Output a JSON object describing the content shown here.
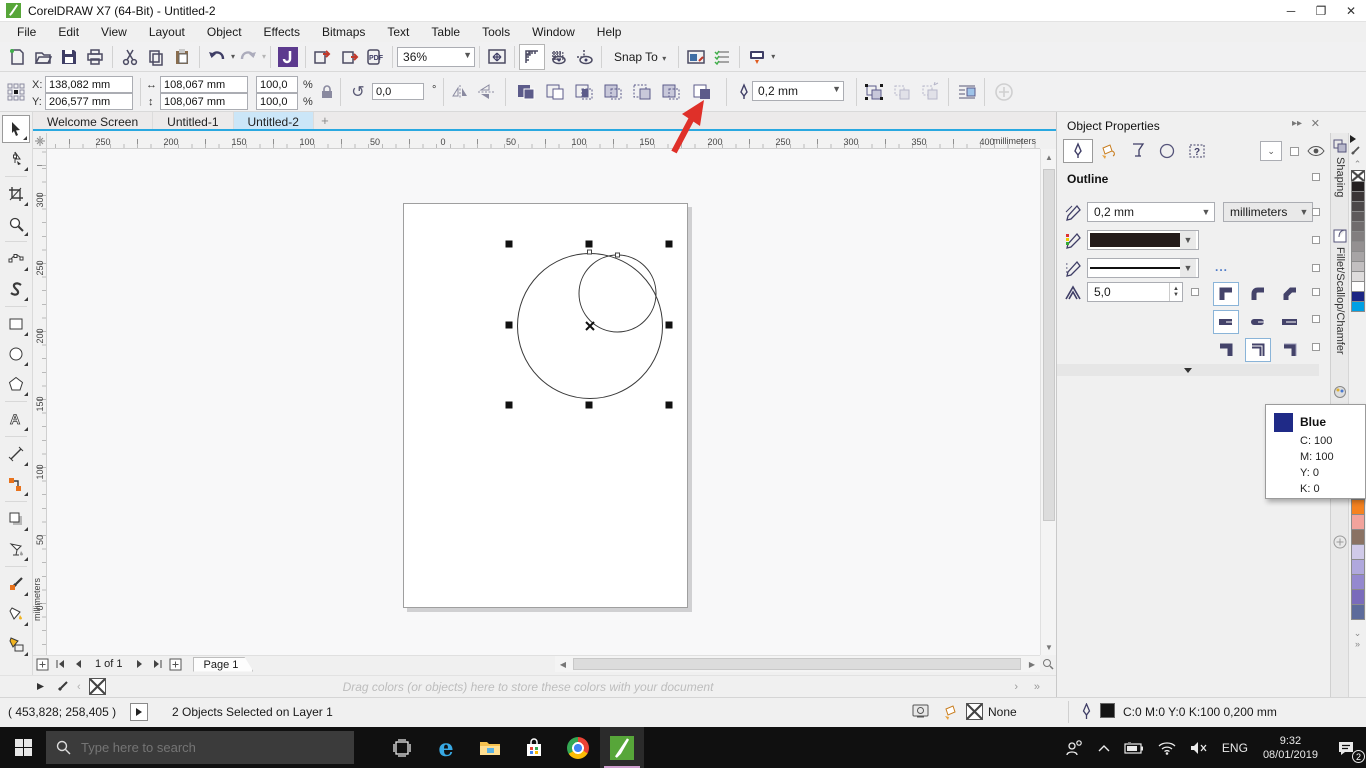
{
  "window": {
    "title": "CorelDRAW X7 (64-Bit) - Untitled-2"
  },
  "menus": [
    "File",
    "Edit",
    "View",
    "Layout",
    "Object",
    "Effects",
    "Bitmaps",
    "Text",
    "Table",
    "Tools",
    "Window",
    "Help"
  ],
  "toolbar": {
    "zoom_value": "36%",
    "snap_label": "Snap To"
  },
  "propbar": {
    "x_label": "X:",
    "y_label": "Y:",
    "x_value": "138,082 mm",
    "y_value": "206,577 mm",
    "width_value": "108,067 mm",
    "height_value": "108,067 mm",
    "scale_h": "100,0",
    "scale_v": "100,0",
    "percent": "%",
    "angle_value": "0,0",
    "degree": "°",
    "outline_width": "0,2 mm"
  },
  "doc_tabs": {
    "tab1": "Welcome Screen",
    "tab2": "Untitled-1",
    "tab3": "Untitled-2",
    "new_tab": "+"
  },
  "rulers": {
    "unit": "millimeters",
    "h_numbers": [
      "250",
      "200",
      "150",
      "100",
      "50",
      "0",
      "50",
      "100",
      "150",
      "200",
      "250",
      "300",
      "350",
      "400"
    ],
    "v_numbers": [
      "300",
      "250",
      "200",
      "150",
      "100",
      "50",
      "0"
    ]
  },
  "object_properties": {
    "title": "Object Properties",
    "section_title": "Outline",
    "width_value": "0,2 mm",
    "units_value": "millimeters",
    "miter_value": "5,0",
    "more_label": "..."
  },
  "docker_tabs": {
    "tab1": "Shaping",
    "tab2": "Fillet/Scallop/Chamfer"
  },
  "tooltip": {
    "name": "Blue",
    "line1": "C: 100",
    "line2": "M: 100",
    "line3": "Y: 0",
    "line4": "K: 0",
    "swatch_color": "#1f2a87"
  },
  "navigation": {
    "page_count": "1 of 1",
    "page_tab": "Page 1"
  },
  "doc_palette_hint": "Drag colors (or objects) here to store these colors with your document",
  "status": {
    "coords": "( 453,828; 258,405 )",
    "selection": "2 Objects Selected on Layer 1",
    "fill_value": "None",
    "outline_value": "C:0 M:0 Y:0 K:100  0,200 mm"
  },
  "taskbar": {
    "search_placeholder": "Type here to search",
    "language": "ENG",
    "time": "9:32",
    "date": "08/01/2019",
    "notification_count": "2"
  },
  "palette_top": [
    "#231f20",
    "#3a3536",
    "#4c4849",
    "#5e5a5b",
    "#706c6d",
    "#827e7f",
    "#949091",
    "#a7a4a5",
    "#c2bfc0",
    "#dedcdc",
    "#ffffff",
    "#1b2583",
    "#00a0e4"
  ],
  "palette_bottom": [
    "#f58220",
    "#f2a39c",
    "#8a7263",
    "#d0cae9",
    "#b0a8dd",
    "#9488cf",
    "#7a6bbb",
    "#5d6b9b"
  ]
}
